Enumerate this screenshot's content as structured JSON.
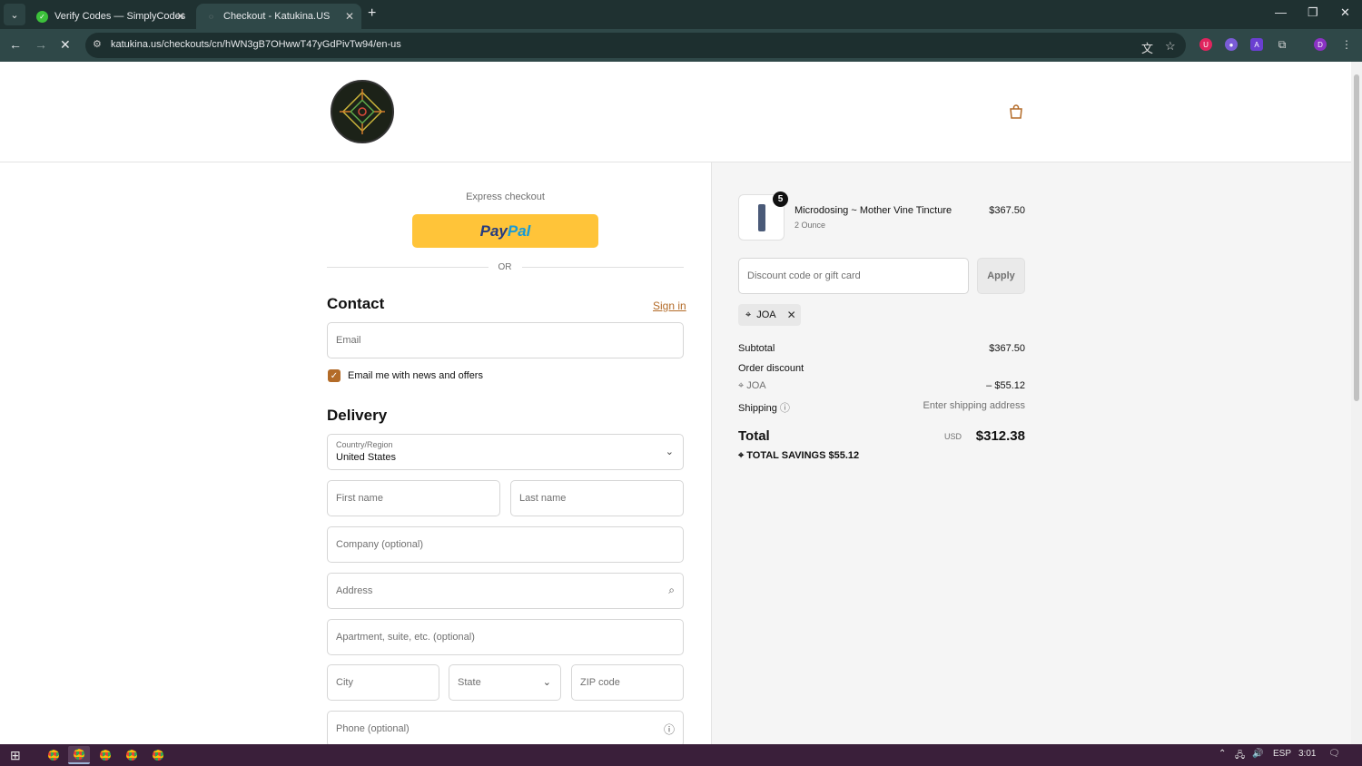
{
  "browser": {
    "tabs": [
      {
        "title": "Verify Codes — SimplyCodes",
        "favicon": "check-icon",
        "active": false
      },
      {
        "title": "Checkout - Katukina.US",
        "favicon": "loading-icon",
        "active": true
      }
    ],
    "url": "katukina.us/checkouts/cn/hWN3gB7OHwwT47yGdPivTw94/en-us",
    "extension_avatar": "D"
  },
  "express": {
    "title": "Express checkout",
    "paypal_a": "Pay",
    "paypal_b": "Pal",
    "or_text": "OR"
  },
  "contact": {
    "title": "Contact",
    "signin": "Sign in",
    "email_placeholder": "Email",
    "newsletter_label": "Email me with news and offers",
    "newsletter_checked": true
  },
  "delivery": {
    "title": "Delivery",
    "country_label": "Country/Region",
    "country_value": "United States",
    "first_name": "First name",
    "last_name": "Last name",
    "company": "Company (optional)",
    "address": "Address",
    "apartment": "Apartment, suite, etc. (optional)",
    "city": "City",
    "state": "State",
    "zip": "ZIP code",
    "phone": "Phone (optional)"
  },
  "summary": {
    "product": {
      "name": "Microdosing ~ Mother Vine Tincture",
      "variant": "2 Ounce",
      "price": "$367.50",
      "quantity": "5"
    },
    "discount_placeholder": "Discount code or gift card",
    "apply_label": "Apply",
    "applied_code": "JOA",
    "subtotal_label": "Subtotal",
    "subtotal_value": "$367.50",
    "order_discount_label": "Order discount",
    "discount_code": "JOA",
    "discount_value": "– $55.12",
    "shipping_label": "Shipping",
    "shipping_value": "Enter shipping address",
    "total_label": "Total",
    "total_currency": "USD",
    "total_value": "$312.38",
    "savings_label": "TOTAL SAVINGS",
    "savings_value": "$55.12"
  },
  "taskbar": {
    "lang": "ESP",
    "time": "3:01"
  },
  "colors": {
    "accent": "#b36b28",
    "paypal": "#ffc439",
    "chrome": "#2f4848",
    "taskbar": "#3a1f3a"
  }
}
